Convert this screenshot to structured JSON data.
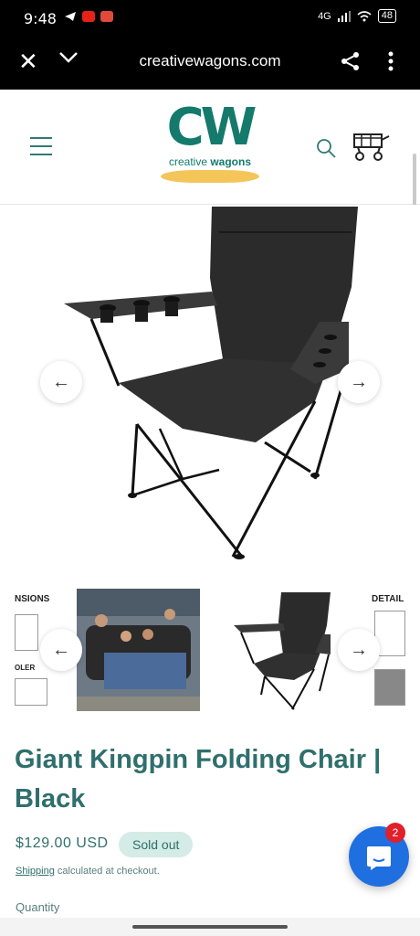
{
  "status_bar": {
    "time": "9:48",
    "network": "4G",
    "battery": "48"
  },
  "browser": {
    "url": "creativewagons.com"
  },
  "header": {
    "logo_mark": "CW",
    "logo_tagline_prefix": "creative",
    "logo_tagline_suffix": "wagons"
  },
  "gallery": {
    "prev_arrow": "←",
    "next_arrow": "→",
    "thumbs": [
      {
        "label_top": "NSIONS",
        "label_mid": "OLER"
      },
      {
        "label_top": ""
      },
      {
        "label_top": ""
      },
      {
        "label_top": "DETAIL"
      }
    ]
  },
  "product": {
    "title": "Giant Kingpin Folding Chair | Black",
    "price": "$129.00 USD",
    "badge": "Sold out",
    "shipping_link": "Shipping",
    "shipping_text": " calculated at checkout.",
    "quantity_label": "Quantity"
  },
  "chat": {
    "badge_count": "2"
  },
  "colors": {
    "accent": "#2f6f6c",
    "brand": "#137a6c",
    "chat": "#1f6fe0"
  }
}
